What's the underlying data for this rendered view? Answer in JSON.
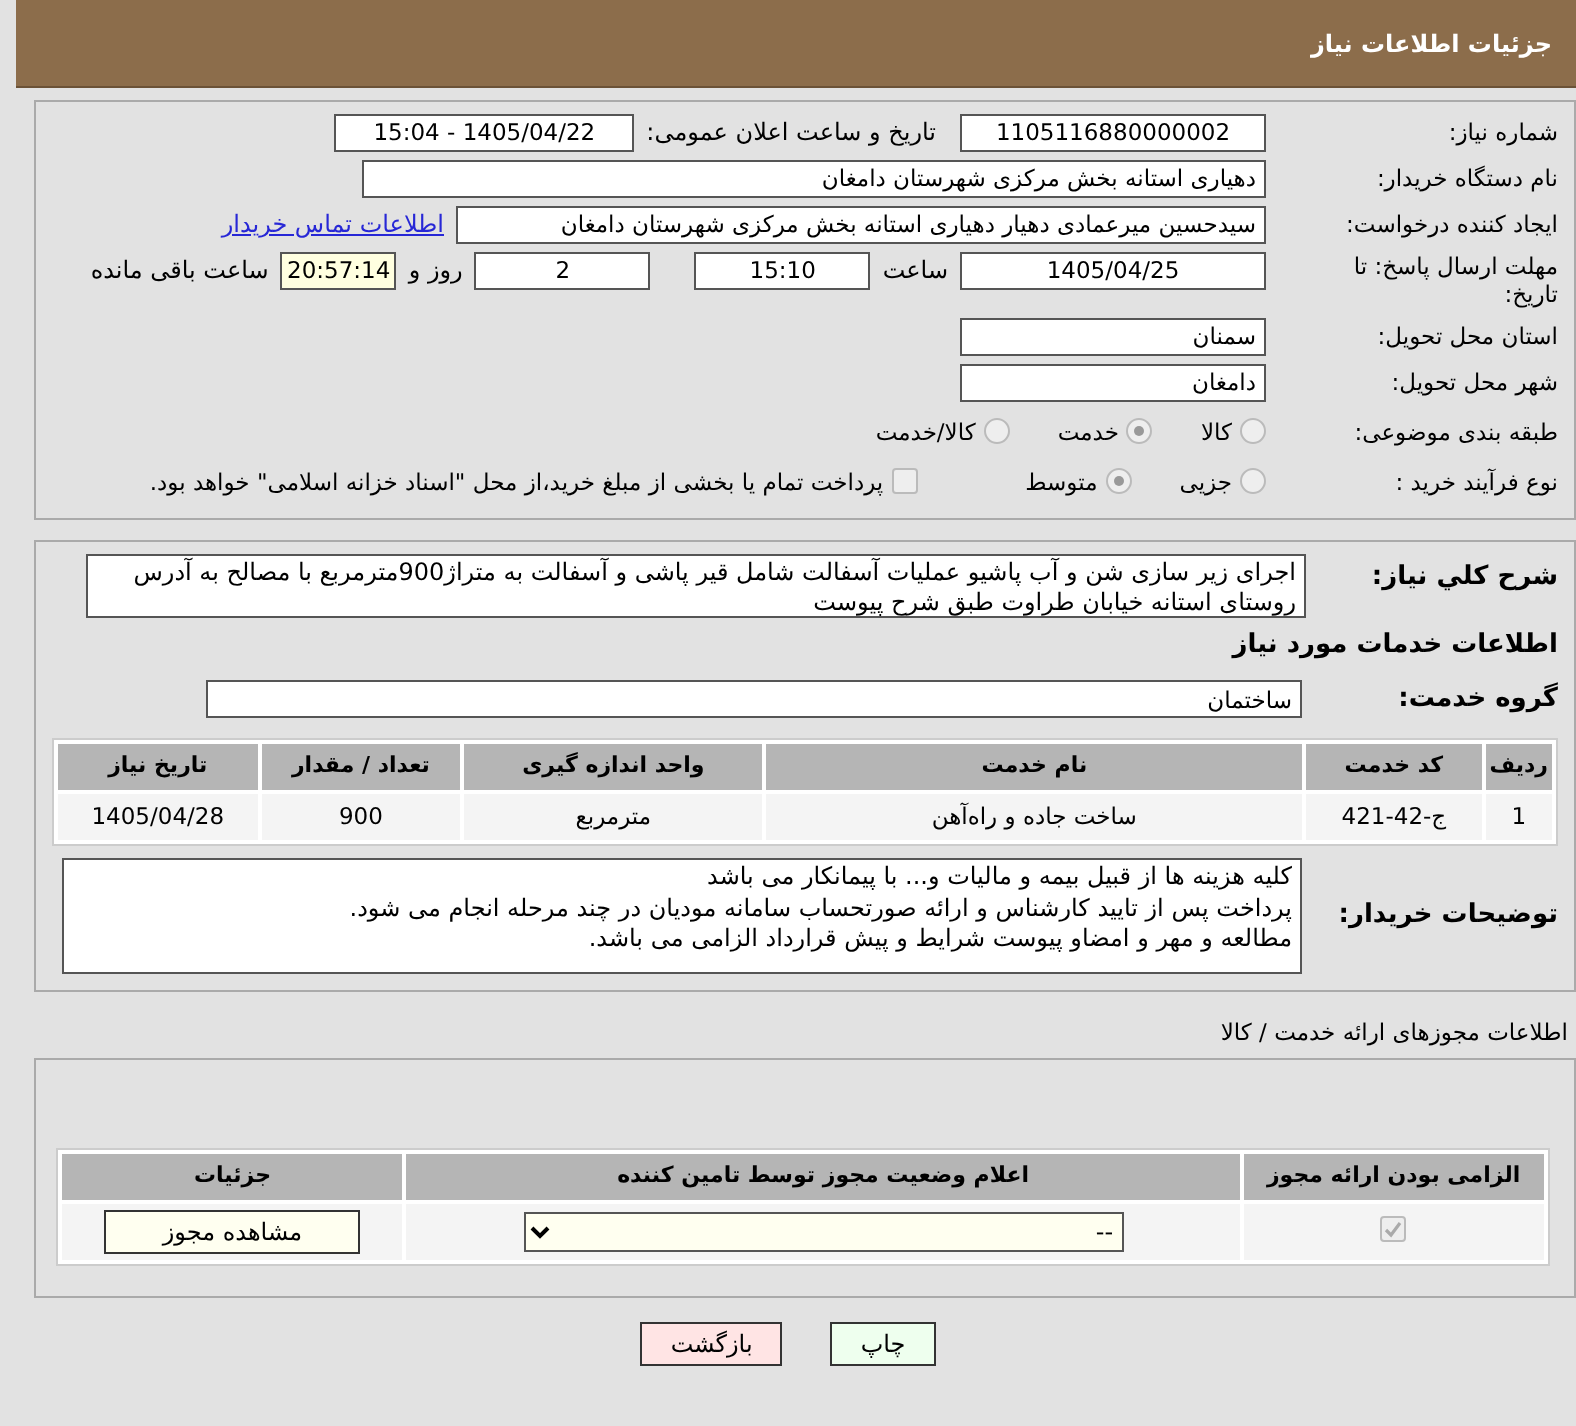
{
  "header": {
    "title": "جزئیات اطلاعات نیاز"
  },
  "need_info": {
    "need_number": {
      "label": "شماره نیاز:",
      "value": "1105116880000002"
    },
    "announce_datetime": {
      "label": "تاریخ و ساعت اعلان عمومی:",
      "value": "1405/04/22 - 15:04"
    },
    "buyer_org": {
      "label": "نام دستگاه خریدار:",
      "value": "دهیاری استانه بخش مرکزی شهرستان دامغان"
    },
    "requester": {
      "label": "ایجاد کننده درخواست:",
      "value": "سیدحسین میرعمادی دهیار دهیاری استانه بخش مرکزی شهرستان دامغان",
      "link": "اطلاعات تماس خریدار"
    },
    "deadline": {
      "label": "مهلت ارسال پاسخ: تا تاریخ:",
      "date": "1405/04/25",
      "time_label": "ساعت",
      "time": "15:10",
      "days": "2",
      "days_label": "روز و",
      "remaining": "20:57:14",
      "remaining_label": "ساعت باقی مانده"
    },
    "province": {
      "label": "استان محل تحویل:",
      "value": "سمنان"
    },
    "city": {
      "label": "شهر محل تحویل:",
      "value": "دامغان"
    },
    "category": {
      "label": "طبقه بندی موضوعی:",
      "options": [
        {
          "label": "کالا",
          "selected": false
        },
        {
          "label": "خدمت",
          "selected": true
        },
        {
          "label": "کالا/خدمت",
          "selected": false
        }
      ]
    },
    "process": {
      "label": "نوع فرآیند خرید :",
      "options": [
        {
          "label": "جزیی",
          "selected": false
        },
        {
          "label": "متوسط",
          "selected": true
        }
      ],
      "payment": {
        "label": "پرداخت تمام یا بخشی از مبلغ خرید،از محل \"اسناد خزانه اسلامی\" خواهد بود.",
        "checked": false
      }
    }
  },
  "services": {
    "description": {
      "label": "شرح کلي نیاز:",
      "value": "اجرای زیر سازی شن و آب پاشیو عملیات آسفالت شامل قیر پاشی و آسفالت  به متراژ900مترمربع  با مصالح به آدرس روستای استانه خیابان طراوت طبق شرح پیوست"
    },
    "heading": "اطلاعات خدمات مورد نیاز",
    "group": {
      "label": "گروه خدمت:",
      "value": "ساختمان"
    },
    "table": {
      "columns": [
        "ردیف",
        "کد خدمت",
        "نام خدمت",
        "واحد اندازه گیری",
        "تعداد / مقدار",
        "تاریخ نیاز"
      ],
      "rows": [
        [
          "1",
          "ج-42-421",
          "ساخت جاده و راه‌آهن",
          "مترمربع",
          "900",
          "1405/04/28"
        ]
      ]
    },
    "buyer_notes": {
      "label": "توضیحات خریدار:",
      "value": "کلیه هزینه ها از قبیل بیمه و مالیات و... با پیمانکار می باشد\nپرداخت پس از تایید کارشناس و ارائه صورتحساب سامانه مودیان در چند مرحله انجام می شود.\nمطالعه و مهر و امضاو پیوست شرایط و پیش قرارداد الزامی می باشد."
    }
  },
  "permits": {
    "heading": "اطلاعات مجوزهای ارائه خدمت / کالا",
    "columns": [
      "الزامی بودن ارائه مجوز",
      "اعلام وضعیت مجوز توسط تامین کننده",
      "جزئیات"
    ],
    "rows": [
      {
        "required": true,
        "status": "--",
        "button": "مشاهده مجوز"
      }
    ]
  },
  "buttons": [
    {
      "label": "چاپ",
      "kind": "print"
    },
    {
      "label": "بازگشت",
      "kind": "back"
    }
  ]
}
